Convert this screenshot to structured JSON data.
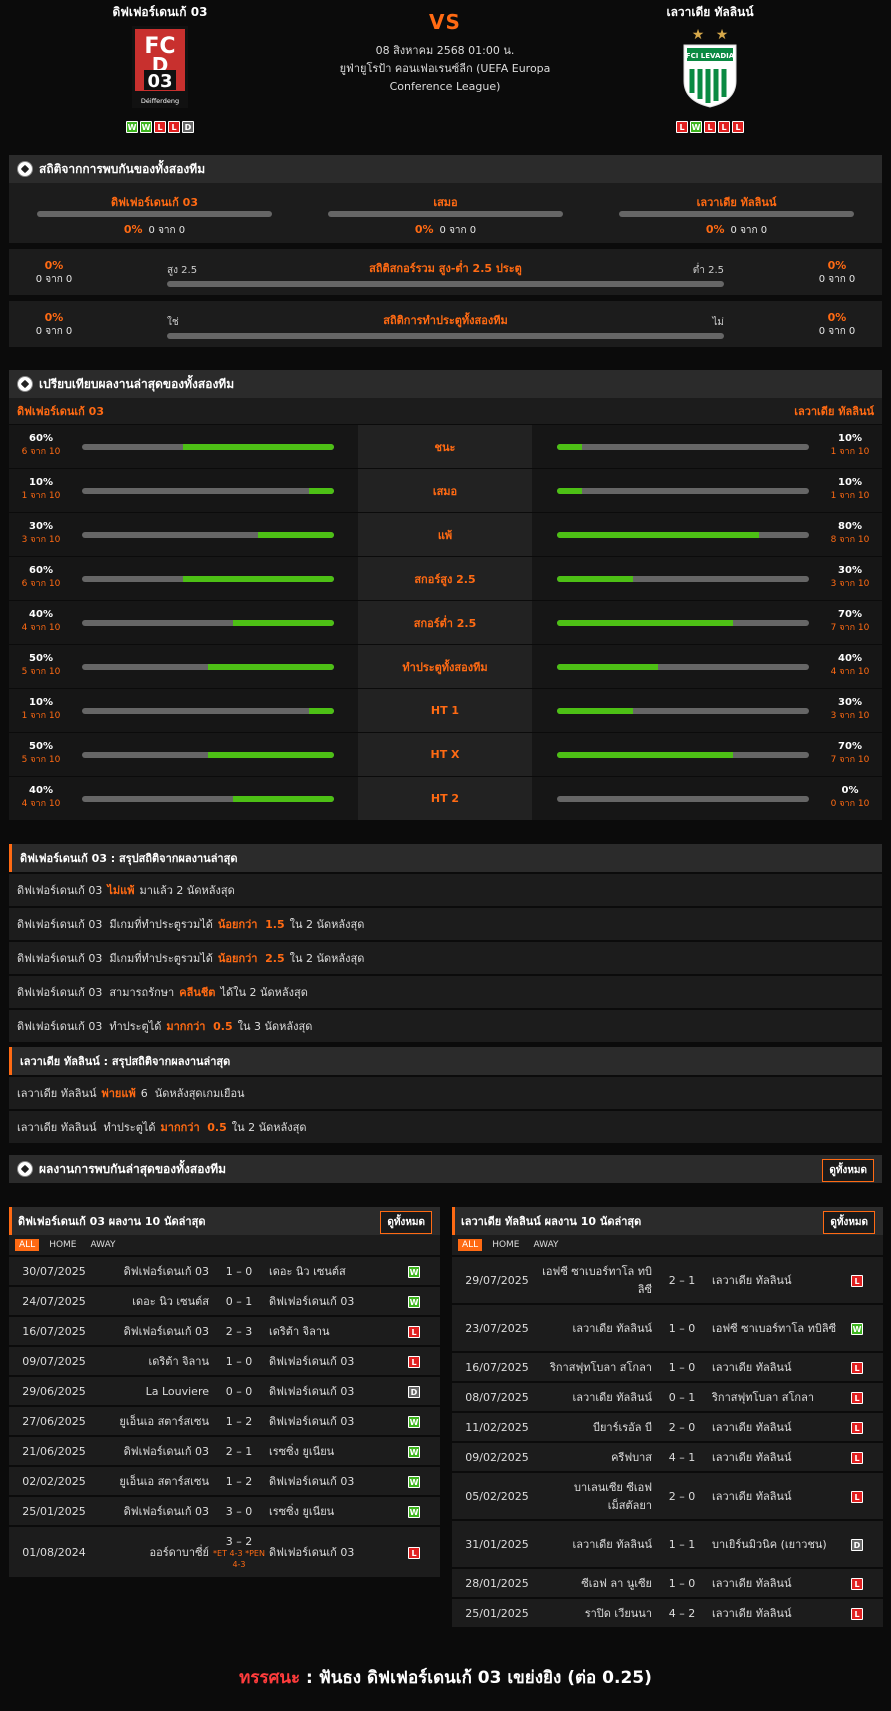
{
  "header": {
    "home_team": "ดิฟเฟอร์เดนเก้ 03",
    "away_team": "เลวาเดีย ทัลลินน์",
    "vs": "VS",
    "datetime": "08 สิงหาคม 2568 01:00 น.",
    "league": "ยูฟ่ายูโรป้า คอนเฟอเรนซ์ลีก (UEFA Europa Conference League)",
    "home_logo_text_top": "FC",
    "home_logo_text_d": "D",
    "home_logo_text_num": "03",
    "home_logo_text_bottom": "Déifferdeng",
    "away_logo_text": "FCI LEVADIA",
    "home_form": [
      "W",
      "W",
      "L",
      "L",
      "D"
    ],
    "away_form": [
      "L",
      "W",
      "L",
      "L",
      "L"
    ]
  },
  "h2h": {
    "title": "สถิติจากการพบกันของทั้งสองทีม",
    "cols": [
      {
        "label": "ดิฟเฟอร์เดนเก้ 03",
        "pct": "0%",
        "count": "0 จาก 0",
        "fill": 0
      },
      {
        "label": "เสมอ",
        "pct": "0%",
        "count": "0 จาก 0",
        "fill": 0
      },
      {
        "label": "เลวาเดีย ทัลลินน์",
        "pct": "0%",
        "count": "0 จาก 0",
        "fill": 0
      }
    ],
    "ou": {
      "title": "สถิติสกอร์รวม สูง-ต่ำ 2.5 ประตู",
      "left_label": "สูง 2.5",
      "right_label": "ต่ำ 2.5",
      "left_pct": "0%",
      "left_count": "0 จาก 0",
      "right_pct": "0%",
      "right_count": "0 จาก 0"
    },
    "btts": {
      "title": "สถิติการทำประตูทั้งสองทีม",
      "left_label": "ใช่",
      "right_label": "ไม่",
      "left_pct": "0%",
      "left_count": "0 จาก 0",
      "right_pct": "0%",
      "right_count": "0 จาก 0"
    }
  },
  "compare": {
    "title": "เปรียบเทียบผลงานล่าสุดของทั้งสองทีม",
    "home_team": "ดิฟเฟอร์เดนเก้ 03",
    "away_team": "เลวาเดีย ทัลลินน์",
    "rows": [
      {
        "label": "ชนะ",
        "home_pct": "60%",
        "home_count": "6 จาก 10",
        "home_fill": 60,
        "away_pct": "10%",
        "away_count": "1 จาก 10",
        "away_fill": 10
      },
      {
        "label": "เสมอ",
        "home_pct": "10%",
        "home_count": "1 จาก 10",
        "home_fill": 10,
        "away_pct": "10%",
        "away_count": "1 จาก 10",
        "away_fill": 10
      },
      {
        "label": "แพ้",
        "home_pct": "30%",
        "home_count": "3 จาก 10",
        "home_fill": 30,
        "away_pct": "80%",
        "away_count": "8 จาก 10",
        "away_fill": 80
      },
      {
        "label": "สกอร์สูง 2.5",
        "home_pct": "60%",
        "home_count": "6 จาก 10",
        "home_fill": 60,
        "away_pct": "30%",
        "away_count": "3 จาก 10",
        "away_fill": 30
      },
      {
        "label": "สกอร์ต่ำ 2.5",
        "home_pct": "40%",
        "home_count": "4 จาก 10",
        "home_fill": 40,
        "away_pct": "70%",
        "away_count": "7 จาก 10",
        "away_fill": 70
      },
      {
        "label": "ทำประตูทั้งสองทีม",
        "home_pct": "50%",
        "home_count": "5 จาก 10",
        "home_fill": 50,
        "away_pct": "40%",
        "away_count": "4 จาก 10",
        "away_fill": 40
      },
      {
        "label": "HT 1",
        "home_pct": "10%",
        "home_count": "1 จาก 10",
        "home_fill": 10,
        "away_pct": "30%",
        "away_count": "3 จาก 10",
        "away_fill": 30
      },
      {
        "label": "HT X",
        "home_pct": "50%",
        "home_count": "5 จาก 10",
        "home_fill": 50,
        "away_pct": "70%",
        "away_count": "7 จาก 10",
        "away_fill": 70
      },
      {
        "label": "HT 2",
        "home_pct": "40%",
        "home_count": "4 จาก 10",
        "home_fill": 40,
        "away_pct": "0%",
        "away_count": "0 จาก 10",
        "away_fill": 0
      }
    ]
  },
  "home_summary": {
    "title": "ดิฟเฟอร์เดนเก้ 03 : สรุปสถิติจากผลงานล่าสุด",
    "rows": [
      {
        "pre": "ดิฟเฟอร์เดนเก้ 03",
        "hl": "ไม่แพ้",
        "post": "มาแล้ว 2 นัดหลังสุด"
      },
      {
        "pre": "ดิฟเฟอร์เดนเก้ 03  มีเกมที่ทำประตูรวมได้",
        "hl": "น้อยกว่า  1.5",
        "post": "ใน 2 นัดหลังสุด"
      },
      {
        "pre": "ดิฟเฟอร์เดนเก้ 03  มีเกมที่ทำประตูรวมได้",
        "hl": "น้อยกว่า  2.5",
        "post": "ใน 2 นัดหลังสุด"
      },
      {
        "pre": "ดิฟเฟอร์เดนเก้ 03  สามารถรักษา",
        "hl": "คลีนชีต",
        "post": "ได้ใน 2 นัดหลังสุด"
      },
      {
        "pre": "ดิฟเฟอร์เดนเก้ 03  ทำประตูได้",
        "hl": "มากกว่า  0.5",
        "post": "ใน 3 นัดหลังสุด"
      }
    ]
  },
  "away_summary": {
    "title": "เลวาเดีย ทัลลินน์ : สรุปสถิติจากผลงานล่าสุด",
    "rows": [
      {
        "pre": "เลวาเดีย ทัลลินน์",
        "hl": "พ่ายแพ้",
        "post": "6  นัดหลังสุดเกมเยือน"
      },
      {
        "pre": "เลวาเดีย ทัลลินน์  ทำประตูได้",
        "hl": "มากกว่า  0.5",
        "post": "ใน 2 นัดหลังสุด"
      }
    ]
  },
  "h2h_results": {
    "title": "ผลงานการพบกันล่าสุดของทั้งสองทีม",
    "see_all": "ดูทั้งหมด"
  },
  "home_results": {
    "title": "ดิฟเฟอร์เดนเก้ 03 ผลงาน 10 นัดล่าสุด",
    "see_all": "ดูทั้งหมด",
    "tabs": [
      "ALL",
      "HOME",
      "AWAY"
    ],
    "rows": [
      {
        "date": "30/07/2025",
        "home": "ดิฟเฟอร์เดนเก้ 03",
        "score": "1 – 0",
        "away": "เดอะ นิว เซนต์ส",
        "res": "W"
      },
      {
        "date": "24/07/2025",
        "home": "เดอะ นิว เซนต์ส",
        "score": "0 – 1",
        "away": "ดิฟเฟอร์เดนเก้ 03",
        "res": "W"
      },
      {
        "date": "16/07/2025",
        "home": "ดิฟเฟอร์เดนเก้ 03",
        "score": "2 – 3",
        "away": "เดริต้า จิลาน",
        "res": "L"
      },
      {
        "date": "09/07/2025",
        "home": "เดริต้า จิลาน",
        "score": "1 – 0",
        "away": "ดิฟเฟอร์เดนเก้ 03",
        "res": "L"
      },
      {
        "date": "29/06/2025",
        "home": "La Louviere",
        "score": "0 – 0",
        "away": "ดิฟเฟอร์เดนเก้ 03",
        "res": "D"
      },
      {
        "date": "27/06/2025",
        "home": "ยูเอ็นเอ สตาร์สเซน",
        "score": "1 – 2",
        "away": "ดิฟเฟอร์เดนเก้ 03",
        "res": "W"
      },
      {
        "date": "21/06/2025",
        "home": "ดิฟเฟอร์เดนเก้ 03",
        "score": "2 – 1",
        "away": "เรซซิ่ง ยูเนียน",
        "res": "W"
      },
      {
        "date": "02/02/2025",
        "home": "ยูเอ็นเอ สตาร์สเซน",
        "score": "1 – 2",
        "away": "ดิฟเฟอร์เดนเก้ 03",
        "res": "W"
      },
      {
        "date": "25/01/2025",
        "home": "ดิฟเฟอร์เดนเก้ 03",
        "score": "3 – 0",
        "away": "เรซซิ่ง ยูเนียน",
        "res": "W"
      },
      {
        "date": "01/08/2024",
        "home": "ออร์ดาบาซี่ย์",
        "score": "3 – 2",
        "score_sub": "*ET 4-3 *PEN 4-3",
        "away": "ดิฟเฟอร์เดนเก้ 03",
        "res": "L"
      }
    ]
  },
  "away_results": {
    "title": "เลวาเดีย ทัลลินน์ ผลงาน 10 นัดล่าสุด",
    "see_all": "ดูทั้งหมด",
    "tabs": [
      "ALL",
      "HOME",
      "AWAY"
    ],
    "rows": [
      {
        "date": "29/07/2025",
        "home": "เอฟซี ซาเบอร์ทาโล ทบิลิซี",
        "score": "2 – 1",
        "away": "เลวาเดีย ทัลลินน์",
        "res": "L"
      },
      {
        "date": "23/07/2025",
        "home": "เลวาเดีย ทัลลินน์",
        "score": "1 – 0",
        "away": "เอฟซี ซาเบอร์ทาโล ทบิลิซี",
        "res": "W"
      },
      {
        "date": "16/07/2025",
        "home": "ริกาสฟุทโบลา สโกลา",
        "score": "1 – 0",
        "away": "เลวาเดีย ทัลลินน์",
        "res": "L"
      },
      {
        "date": "08/07/2025",
        "home": "เลวาเดีย ทัลลินน์",
        "score": "0 – 1",
        "away": "ริกาสฟุทโบลา สโกลา",
        "res": "L"
      },
      {
        "date": "11/02/2025",
        "home": "บียาร์เรอัล บี",
        "score": "2 – 0",
        "away": "เลวาเดีย ทัลลินน์",
        "res": "L"
      },
      {
        "date": "09/02/2025",
        "home": "ครีฟบาส",
        "score": "4 – 1",
        "away": "เลวาเดีย ทัลลินน์",
        "res": "L"
      },
      {
        "date": "05/02/2025",
        "home": "บาเลนเซีย ซีเอฟ เม็สตัลยา",
        "score": "2 – 0",
        "away": "เลวาเดีย ทัลลินน์",
        "res": "L"
      },
      {
        "date": "31/01/2025",
        "home": "เลวาเดีย ทัลลินน์",
        "score": "1 – 1",
        "away": "บาเยิร์นมิวนิค (เยาวชน)",
        "res": "D"
      },
      {
        "date": "28/01/2025",
        "home": "ซีเอฟ ลา นูเซีย",
        "score": "1 – 0",
        "away": "เลวาเดีย ทัลลินน์",
        "res": "L"
      },
      {
        "date": "25/01/2025",
        "home": "ราปิด เวียนนา",
        "score": "4 – 2",
        "away": "เลวาเดีย ทัลลินน์",
        "res": "L"
      }
    ]
  },
  "tips": {
    "label": "ทรรศนะ",
    "sep": " : ",
    "text": "ฟันธง ดิฟเฟอร์เดนเก้ 03 เขย่งยิง (ต่อ 0.25)"
  },
  "colors": {
    "accent": "#ff6a13",
    "win": "#3eb51f",
    "loss": "#e02020",
    "draw": "#666666",
    "bar_fill": "#4dc015"
  }
}
